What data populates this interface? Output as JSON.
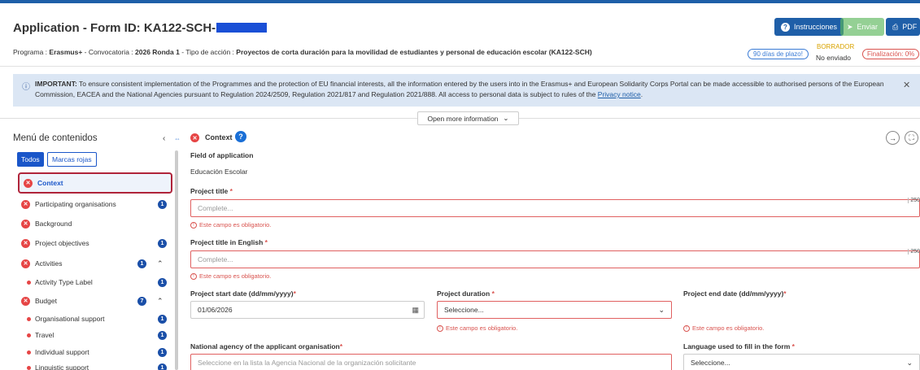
{
  "header": {
    "title": "Application - Form ID: KA122-SCH-",
    "meta_programa_label": "Programa : ",
    "meta_programa": "Erasmus+",
    "meta_convocatoria_label": " - Convocatoria : ",
    "meta_convocatoria": "2026 Ronda 1",
    "meta_accion_label": " - Tipo de acción : ",
    "meta_accion": "Proyectos de corta duración para la movilidad de estudiantes y personal de educación escolar (KA122-SCH)",
    "days_left": "90 días de plazo!",
    "status_draft": "BORRADOR",
    "status_sent": "No enviado",
    "completion": "Finalización: 0%",
    "buttons": {
      "instructions": "Instrucciones",
      "send": "Enviar",
      "pdf": "PDF"
    }
  },
  "notice": {
    "bold": "IMPORTANT:",
    "text": " To ensure consistent implementation of the Programmes and the protection of EU financial interests, all the information entered by the users into in the Erasmus+ and European Solidarity Corps Portal can be made accessible to authorised persons of the European Commission, EACEA and the National Agencies pursuant to Regulation 2024/2509, Regulation 2021/817 and Regulation 2021/888. All access to personal data is subject to rules of the ",
    "link": "Privacy notice",
    "end": "."
  },
  "open_more": "Open more information",
  "sidebar": {
    "title": "Menú de contenidos",
    "tab_all": "Todos",
    "tab_red": "Marcas rojas",
    "items": [
      {
        "label": "Context",
        "kind": "error",
        "count": ""
      },
      {
        "label": "Participating organisations",
        "kind": "error",
        "count": "1"
      },
      {
        "label": "Background",
        "kind": "error",
        "count": ""
      },
      {
        "label": "Project objectives",
        "kind": "error",
        "count": "1"
      },
      {
        "label": "Activities",
        "kind": "error",
        "count": "1"
      },
      {
        "label": "Activity Type Label",
        "kind": "sub",
        "count": "1"
      },
      {
        "label": "Budget",
        "kind": "error",
        "count": "7"
      },
      {
        "label": "Organisational support",
        "kind": "sub",
        "count": "1"
      },
      {
        "label": "Travel",
        "kind": "sub",
        "count": "1"
      },
      {
        "label": "Individual support",
        "kind": "sub",
        "count": "1"
      },
      {
        "label": "Linguistic support",
        "kind": "sub",
        "count": "1"
      }
    ]
  },
  "form": {
    "section_title": "Context",
    "field_of_application_label": "Field of application",
    "field_of_application_value": "Educación Escolar",
    "project_title_label": "Project title",
    "project_title_placeholder": "Complete...",
    "project_title_en_label": "Project title in English",
    "project_title_en_placeholder": "Complete...",
    "required_error": "Este campo es obligatorio.",
    "counter": "250",
    "start_date_label": "Project start date (dd/mm/yyyy)",
    "start_date_value": "01/06/2026",
    "duration_label": "Project duration",
    "duration_placeholder": "Seleccione...",
    "end_date_label": "Project end date (dd/mm/yyyy)",
    "national_agency_label": "National agency of the applicant organisation",
    "national_agency_placeholder": "Seleccione en la lista la Agencia Nacional de la organización solicitante",
    "language_label": "Language used to fill in the form",
    "language_placeholder": "Seleccione...",
    "req_mark": "*"
  }
}
